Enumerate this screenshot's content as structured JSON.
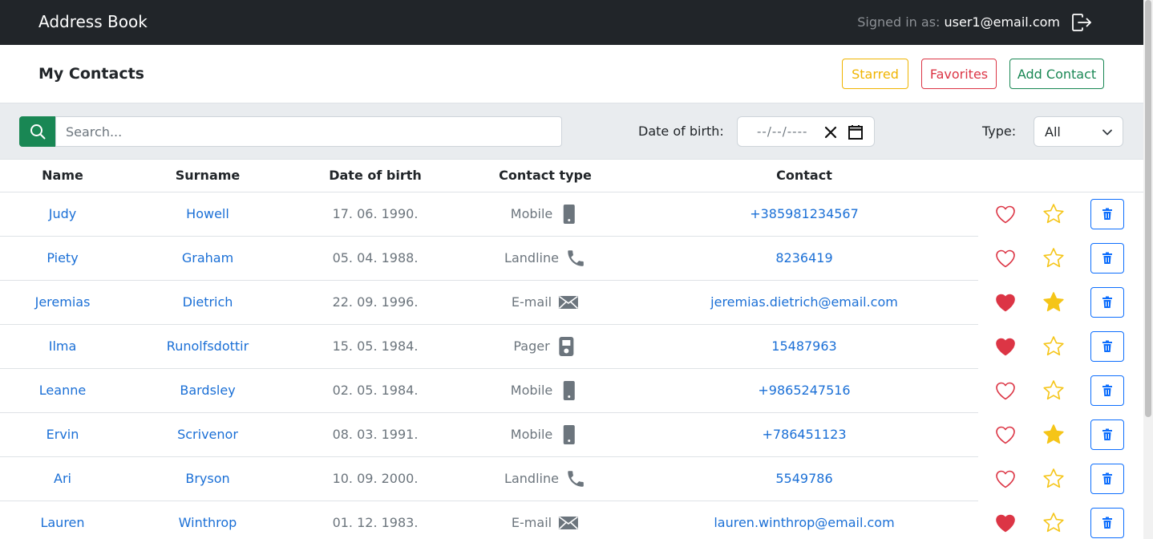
{
  "navbar": {
    "brand": "Address Book",
    "signed_in_label": "Signed in as:",
    "signed_in_email": "user1@email.com",
    "logout_icon": "logout-icon"
  },
  "header": {
    "title": "My Contacts",
    "starred_label": "Starred",
    "favorites_label": "Favorites",
    "add_contact_label": "Add Contact"
  },
  "filters": {
    "search_placeholder": "Search...",
    "search_value": "",
    "dob_label": "Date of birth:",
    "dob_placeholder": "--/--/----",
    "type_label": "Type:",
    "type_value": "All"
  },
  "table": {
    "headers": {
      "name": "Name",
      "surname": "Surname",
      "dob": "Date of birth",
      "contact_type": "Contact type",
      "contact": "Contact"
    },
    "rows": [
      {
        "name": "Judy",
        "surname": "Howell",
        "dob": "17. 06. 1990.",
        "type": "Mobile",
        "icon": "mobile-icon",
        "contact": "+385981234567",
        "favorite": false,
        "starred": false
      },
      {
        "name": "Piety",
        "surname": "Graham",
        "dob": "05. 04. 1988.",
        "type": "Landline",
        "icon": "phone-icon",
        "contact": "8236419",
        "favorite": false,
        "starred": false
      },
      {
        "name": "Jeremias",
        "surname": "Dietrich",
        "dob": "22. 09. 1996.",
        "type": "E-mail",
        "icon": "envelope-icon",
        "contact": "jeremias.dietrich@email.com",
        "favorite": true,
        "starred": true
      },
      {
        "name": "Ilma",
        "surname": "Runolfsdottir",
        "dob": "15. 05. 1984.",
        "type": "Pager",
        "icon": "pager-icon",
        "contact": "15487963",
        "favorite": true,
        "starred": false
      },
      {
        "name": "Leanne",
        "surname": "Bardsley",
        "dob": "02. 05. 1984.",
        "type": "Mobile",
        "icon": "mobile-icon",
        "contact": "+9865247516",
        "favorite": false,
        "starred": false
      },
      {
        "name": "Ervin",
        "surname": "Scrivenor",
        "dob": "08. 03. 1991.",
        "type": "Mobile",
        "icon": "mobile-icon",
        "contact": "+786451123",
        "favorite": false,
        "starred": true
      },
      {
        "name": "Ari",
        "surname": "Bryson",
        "dob": "10. 09. 2000.",
        "type": "Landline",
        "icon": "phone-icon",
        "contact": "5549786",
        "favorite": false,
        "starred": false
      },
      {
        "name": "Lauren",
        "surname": "Winthrop",
        "dob": "01. 12. 1983.",
        "type": "E-mail",
        "icon": "envelope-icon",
        "contact": "lauren.winthrop@email.com",
        "favorite": true,
        "starred": false
      }
    ]
  },
  "colors": {
    "navbar_bg": "#212529",
    "accent_green": "#198754",
    "heart_red": "#dc3545",
    "star_yellow": "#f5c518",
    "link_blue": "#1a6fd6",
    "trash_blue": "#0d6efd"
  }
}
